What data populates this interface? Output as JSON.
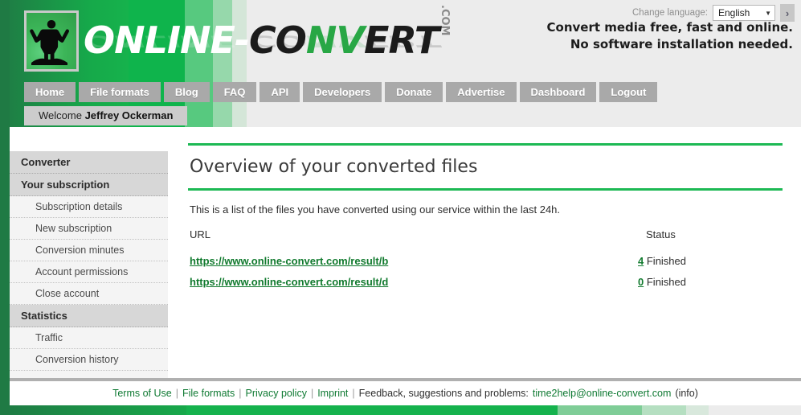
{
  "header": {
    "logo_alt": "online-convert logo",
    "wordmark_white": "ONLINE-",
    "wordmark_dark1": "CO",
    "wordmark_green": "NV",
    "wordmark_dark2": "ERT",
    "wordmark_tld": ".COM",
    "language_label": "Change language:",
    "language_value": "English",
    "language_go": "›",
    "tagline_line1": "Convert media free, fast and online.",
    "tagline_line2": "No software installation needed."
  },
  "nav": {
    "items": [
      {
        "label": "Home"
      },
      {
        "label": "File formats"
      },
      {
        "label": "Blog"
      },
      {
        "label": "FAQ"
      },
      {
        "label": "API"
      },
      {
        "label": "Developers"
      },
      {
        "label": "Donate"
      },
      {
        "label": "Advertise"
      },
      {
        "label": "Dashboard"
      },
      {
        "label": "Logout"
      }
    ],
    "welcome_prefix": "Welcome ",
    "welcome_user": "Jeffrey Ockerman"
  },
  "sidebar": {
    "items": [
      {
        "label": "Converter",
        "type": "head"
      },
      {
        "label": "Your subscription",
        "type": "head"
      },
      {
        "label": "Subscription details",
        "type": "link"
      },
      {
        "label": "New subscription",
        "type": "link"
      },
      {
        "label": "Conversion minutes",
        "type": "link"
      },
      {
        "label": "Account permissions",
        "type": "link"
      },
      {
        "label": "Close account",
        "type": "link"
      },
      {
        "label": "Statistics",
        "type": "head"
      },
      {
        "label": "Traffic",
        "type": "link"
      },
      {
        "label": "Conversion history",
        "type": "link"
      }
    ]
  },
  "main": {
    "title": "Overview of your converted files",
    "intro": "This is a list of the files you have converted using our service within the last 24h.",
    "columns": {
      "url": "URL",
      "status": "Status"
    },
    "rows": [
      {
        "url": "https://www.online-convert.com/result/b",
        "status_fragment": "4",
        "status": "Finished"
      },
      {
        "url": "https://www.online-convert.com/result/d",
        "status_fragment": "0",
        "status": "Finished"
      }
    ]
  },
  "footer": {
    "links": [
      {
        "label": "Terms of Use"
      },
      {
        "label": "File formats"
      },
      {
        "label": "Privacy policy"
      },
      {
        "label": "Imprint"
      }
    ],
    "feedback_label": "Feedback, suggestions and problems:",
    "email": "time2help@online-convert.com",
    "info": "(info)",
    "separator": "|"
  },
  "colors": {
    "brand_green": "#1db954",
    "dark_green": "#1f7a44",
    "link_green": "#117a2e",
    "nav_gray": "#a9a9a9"
  }
}
